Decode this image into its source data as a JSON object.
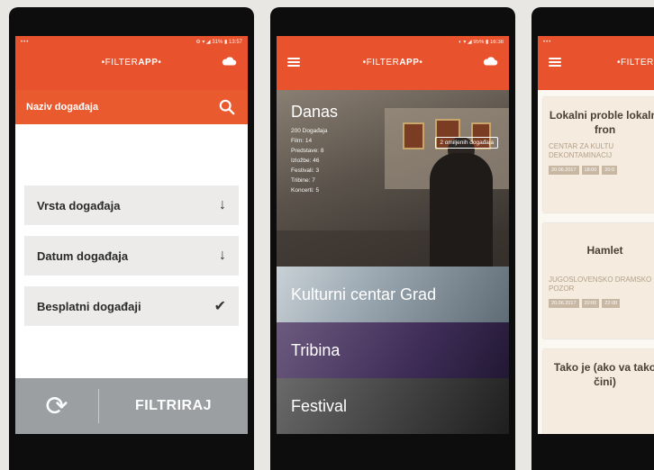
{
  "phone1": {
    "brand_prefix": "•FILTER",
    "brand_bold": "APP",
    "brand_suffix": "•",
    "status_left": "•••",
    "status_right": "⚙ ▾ ◢ 31% ▮ 13:57",
    "search_label": "Naziv događaja",
    "filters": [
      {
        "label": "Vrsta događaja",
        "icon": "↓"
      },
      {
        "label": "Datum događaja",
        "icon": "↓"
      },
      {
        "label": "Besplatni događaji",
        "icon": "✔"
      }
    ],
    "refresh_icon": "⟳",
    "filter_button": "FILTRIRAJ"
  },
  "phone2": {
    "brand_prefix": "•FILTER",
    "brand_bold": "APP",
    "brand_suffix": "•",
    "status_right": "◐ ▾ ◢ 95% ▮ 16:38",
    "hero_title": "Danas",
    "hero_list": [
      "200 Događaja",
      "Film: 14",
      "Predstave: 8",
      "Izložbe: 46",
      "Festivali: 3",
      "Tribine: 7",
      "Koncerti: 5"
    ],
    "hero_badge": "2 omiljenih događaja",
    "categories": [
      "Kulturni centar Grad",
      "Tribina",
      "Festival"
    ]
  },
  "phone3": {
    "brand_prefix": "•FILTER",
    "status_left": "•••",
    "cards": [
      {
        "title": "Lokalni proble lokalni fron",
        "subtitle": "CENTAR ZA KULTU DEKONTAMINACIJ",
        "dates": [
          "20.06.2017",
          "18:00",
          "20:0"
        ]
      },
      {
        "title": "Hamlet",
        "subtitle": "JUGOSLOVENSKO DRAMSKO POZOR",
        "dates": [
          "20.06.2017",
          "20:00",
          "22:00"
        ]
      },
      {
        "title": "Tako je (ako va tako čini)",
        "subtitle": "",
        "dates": []
      }
    ]
  },
  "colors": {
    "accent": "#e8532d",
    "bottom_bar": "#9c9fa1",
    "filter_item_bg": "#ecebea"
  }
}
